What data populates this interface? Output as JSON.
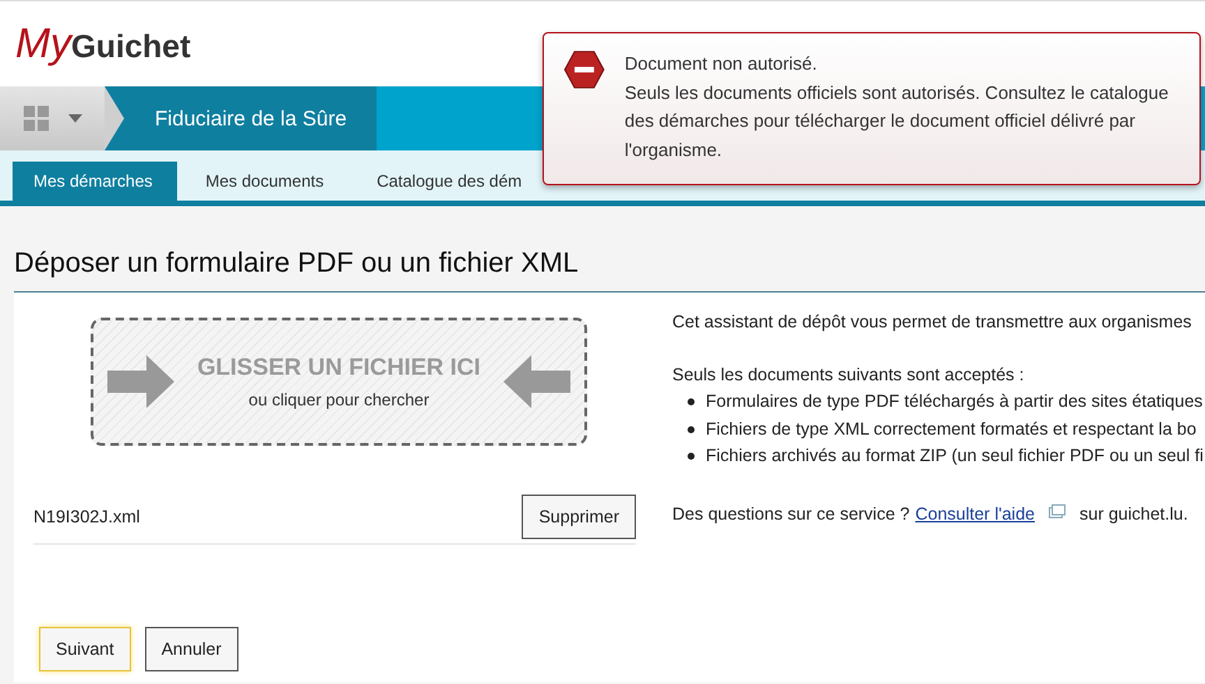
{
  "logo": {
    "my": "My",
    "name": "Guichet"
  },
  "breadcrumb": {
    "title": "Fiduciaire de la Sûre"
  },
  "tabs": [
    {
      "label": "Mes démarches",
      "selected": true
    },
    {
      "label": "Mes documents",
      "selected": false
    },
    {
      "label": "Catalogue des dém",
      "selected": false
    }
  ],
  "alert": {
    "title": "Document non autorisé.",
    "message": "Seuls les documents officiels sont autorisés. Consultez le catalogue des démarches pour télécharger le document officiel délivré par l'organisme."
  },
  "page_title": "Déposer un formulaire PDF ou un fichier XML",
  "dropzone": {
    "title": "GLISSER UN FICHIER ICI",
    "subtitle": "ou cliquer pour chercher"
  },
  "files": [
    {
      "name": "N19I302J.xml",
      "action": "Supprimer"
    }
  ],
  "info": {
    "intro": "Cet assistant de dépôt vous permet de transmettre aux organismes",
    "accepted_heading": "Seuls les documents suivants sont acceptés :",
    "accepted": [
      "Formulaires de type PDF téléchargés à partir des sites étatiques",
      "Fichiers de type XML correctement formatés et respectant la bo",
      "Fichiers archivés au format ZIP (un seul fichier PDF ou un seul fi"
    ],
    "help_prefix": "Des questions sur ce service ?",
    "help_link": "Consulter l'aide",
    "help_suffix": "sur guichet.lu."
  },
  "buttons": [
    {
      "label": "Suivant",
      "selected": true
    },
    {
      "label": "Annuler",
      "selected": false
    }
  ]
}
